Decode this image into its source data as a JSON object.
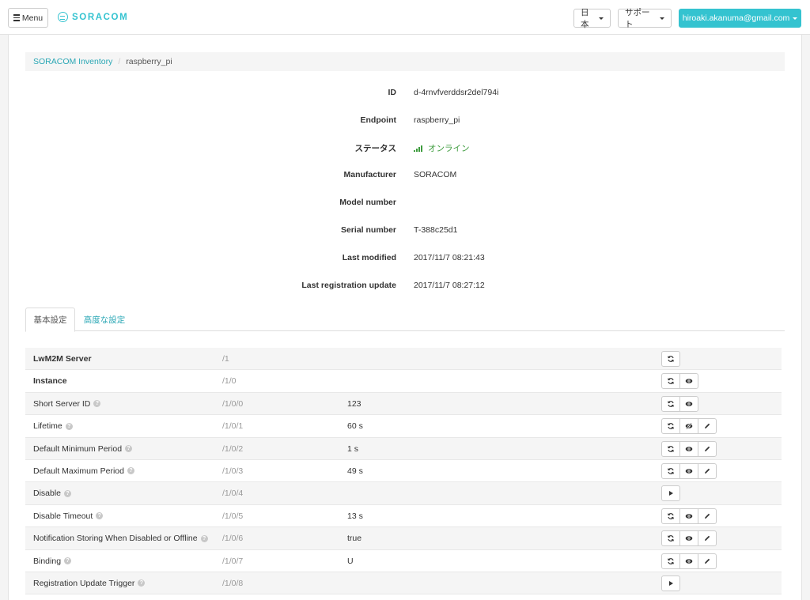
{
  "navbar": {
    "menu_label": "Menu",
    "logo_text": "SORACOM",
    "language_label": "日本",
    "support_label": "サポート",
    "user_email": "hiroaki.akanuma@gmail.com"
  },
  "breadcrumb": {
    "parent": "SORACOM Inventory",
    "current": "raspberry_pi"
  },
  "details": {
    "id": {
      "label": "ID",
      "value": "d-4rnvfverddsr2del794i"
    },
    "endpoint": {
      "label": "Endpoint",
      "value": "raspberry_pi"
    },
    "status": {
      "label": "ステータス",
      "value": "オンライン"
    },
    "manufacturer": {
      "label": "Manufacturer",
      "value": "SORACOM"
    },
    "model_number": {
      "label": "Model number",
      "value": ""
    },
    "serial_number": {
      "label": "Serial number",
      "value": "T-388c25d1"
    },
    "last_modified": {
      "label": "Last modified",
      "value": "2017/11/7 08:21:43"
    },
    "last_registration_update": {
      "label": "Last registration update",
      "value": "2017/11/7 08:27:12"
    }
  },
  "tabs": [
    {
      "label": "基本設定",
      "active": true
    },
    {
      "label": "高度な設定",
      "active": false
    }
  ],
  "resources": [
    {
      "name": "LwM2M Server",
      "path": "/1",
      "value": "",
      "bold": true,
      "help": false,
      "actions": [
        "refresh-icon"
      ]
    },
    {
      "name": "Instance",
      "path": "/1/0",
      "value": "",
      "bold": true,
      "help": false,
      "actions": [
        "refresh-icon",
        "eye-icon"
      ]
    },
    {
      "name": "Short Server ID",
      "path": "/1/0/0",
      "value": "123",
      "bold": false,
      "help": true,
      "actions": [
        "refresh-icon",
        "eye-icon"
      ]
    },
    {
      "name": "Lifetime",
      "path": "/1/0/1",
      "value": "60 s",
      "bold": false,
      "help": true,
      "actions": [
        "refresh-icon",
        "eye-off-icon",
        "pencil-icon"
      ]
    },
    {
      "name": "Default Minimum Period",
      "path": "/1/0/2",
      "value": "1 s",
      "bold": false,
      "help": true,
      "actions": [
        "refresh-icon",
        "eye-icon",
        "pencil-icon"
      ]
    },
    {
      "name": "Default Maximum Period",
      "path": "/1/0/3",
      "value": "49 s",
      "bold": false,
      "help": true,
      "actions": [
        "refresh-icon",
        "eye-icon",
        "pencil-icon"
      ]
    },
    {
      "name": "Disable",
      "path": "/1/0/4",
      "value": "",
      "bold": false,
      "help": true,
      "actions": [
        "play-icon"
      ]
    },
    {
      "name": "Disable Timeout",
      "path": "/1/0/5",
      "value": "13 s",
      "bold": false,
      "help": true,
      "actions": [
        "refresh-icon",
        "eye-icon",
        "pencil-icon"
      ]
    },
    {
      "name": "Notification Storing When Disabled or Offline",
      "path": "/1/0/6",
      "value": "true",
      "bold": false,
      "help": true,
      "actions": [
        "refresh-icon",
        "eye-icon",
        "pencil-icon"
      ]
    },
    {
      "name": "Binding",
      "path": "/1/0/7",
      "value": "U",
      "bold": false,
      "help": true,
      "actions": [
        "refresh-icon",
        "eye-icon",
        "pencil-icon"
      ]
    },
    {
      "name": "Registration Update Trigger",
      "path": "/1/0/8",
      "value": "",
      "bold": false,
      "help": true,
      "actions": [
        "play-icon"
      ]
    }
  ],
  "colors": {
    "accent": "#34c3d0",
    "link": "#2aa7b5",
    "online": "#3c9b3c"
  }
}
